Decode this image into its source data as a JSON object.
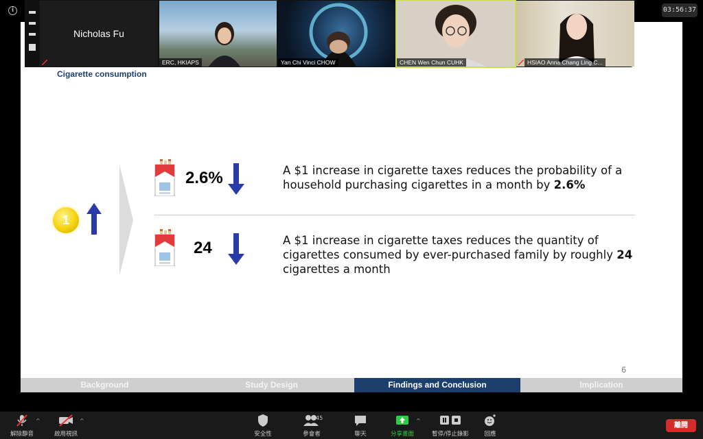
{
  "clock": "03:56:37",
  "slide": {
    "title": "Cigarette consumption",
    "row1": {
      "stat": "2.6%",
      "desc_main": "A $1 increase in cigarette taxes reduces the probability of a household purchasing cigarettes in a month by ",
      "desc_bold": "2.6%"
    },
    "row2": {
      "stat": "24",
      "desc_main": "A $1 increase in cigarette taxes reduces the quantity of cigarettes consumed by ever-purchased family by roughly ",
      "desc_bold": "24",
      "desc_tail": " cigarettes a month"
    },
    "coin_label": "1",
    "page_number": "6",
    "nav": [
      "Background",
      "Study Design",
      "Findings and Conclusion",
      "Implication"
    ],
    "nav_active": "Findings and Conclusion",
    "colors": {
      "accent": "#1c3f6e",
      "arrow": "#2a3aa8",
      "coin": "#f4d20c"
    }
  },
  "participants": [
    {
      "name": "Nicholas Fu"
    },
    {
      "name": "ERC, HKIAPS"
    },
    {
      "name": "Yan Chi Vinci CHOW"
    },
    {
      "name": "CHEN Wen Chun CUHK"
    },
    {
      "name": "HSIAO Anna Chang Ling C..."
    }
  ],
  "toolbar": {
    "unmute": "解除靜音",
    "start_video": "啟用視訊",
    "security": "安全性",
    "participants": "參會者",
    "participants_count": "45",
    "chat": "聊天",
    "share_screen": "分享畫面",
    "pause_share": "暫停/停止錄影",
    "reactions": "回應",
    "leave": "離開"
  }
}
